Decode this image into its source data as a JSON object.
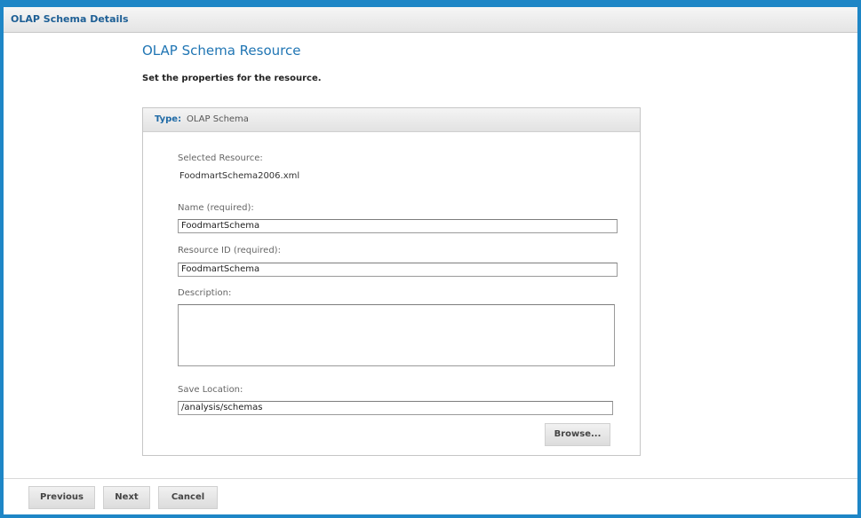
{
  "window": {
    "title": "OLAP Schema Details",
    "accent_color": "#1e86c6"
  },
  "page": {
    "heading": "OLAP Schema Resource",
    "subheading": "Set the properties for the resource."
  },
  "panel": {
    "type_label": "Type:",
    "type_value": "OLAP Schema",
    "selected_resource_label": "Selected Resource:",
    "selected_resource_value": "FoodmartSchema2006.xml",
    "name_label": "Name (required):",
    "name_value": "FoodmartSchema",
    "resource_id_label": "Resource ID (required):",
    "resource_id_value": "FoodmartSchema",
    "description_label": "Description:",
    "description_value": "",
    "save_location_label": "Save Location:",
    "save_location_value": "/analysis/schemas",
    "browse_label": "Browse..."
  },
  "footer": {
    "previous_label": "Previous",
    "next_label": "Next",
    "cancel_label": "Cancel"
  }
}
